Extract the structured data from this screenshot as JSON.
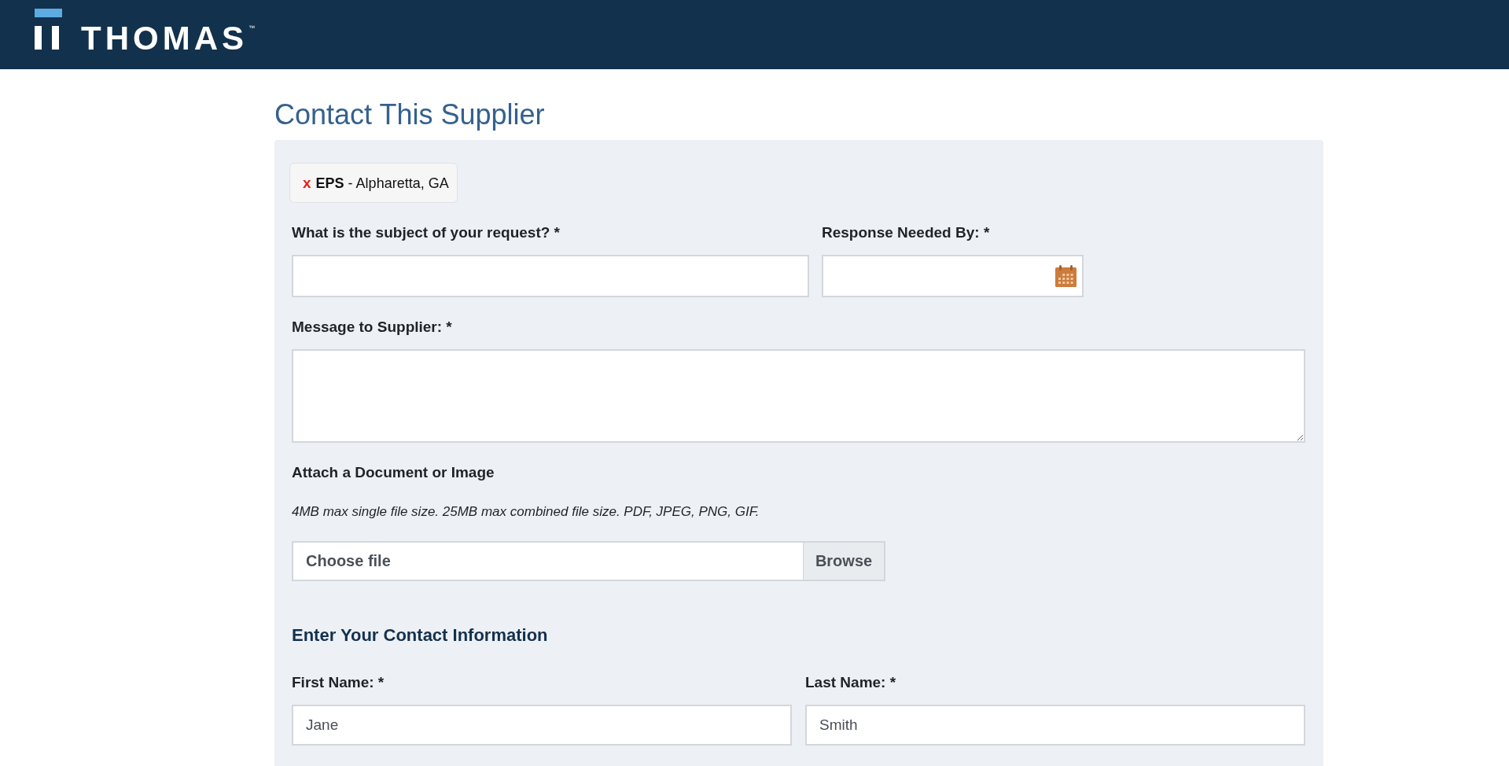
{
  "header": {
    "logo": {
      "wordmark": "THOMAS",
      "trademark": "™"
    }
  },
  "title": "Contact This Supplier",
  "supplier_tag": {
    "remove": "x",
    "label": "**EPS** - Alpharetta, GA"
  },
  "request_rows": [
    {
      "fields": [
        {
          "kind": "text",
          "label": "What is the subject of your request? *"
        },
        {
          "kind": "date",
          "label": "Response Needed By: *"
        }
      ]
    },
    {
      "fields": [
        {
          "kind": "textarea",
          "label": "Message to Supplier: *"
        }
      ]
    }
  ],
  "attachment": {
    "label": "Attach a Document or Image",
    "hint": "4MB max single file size. 25MB max combined file size. PDF, JPEG, PNG, GIF.",
    "file_field": {
      "text": "Choose file",
      "button": "Browse"
    }
  },
  "contact": {
    "heading": "Enter Your Contact Information",
    "fields": [
      {
        "kind": "text",
        "label": "First Name: *",
        "value": "Jane"
      },
      {
        "kind": "text",
        "label": "Last Name: *",
        "value": "Smith"
      }
    ]
  }
}
